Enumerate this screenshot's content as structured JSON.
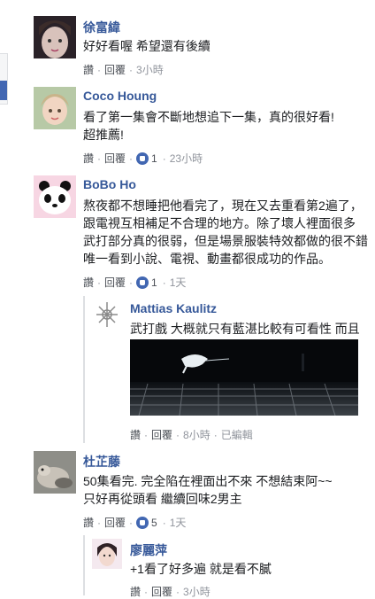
{
  "comments": [
    {
      "name": "徐富緯",
      "lines": [
        "好好看喔 希望還有後續"
      ],
      "actions": {
        "like": "讚",
        "reply": "回覆",
        "time": "3小時"
      }
    },
    {
      "name": "Coco Houng",
      "lines": [
        "看了第一集會不斷地想追下一集，真的很好看!",
        "超推薦!"
      ],
      "actions": {
        "like": "讚",
        "reply": "回覆",
        "reactions": "1",
        "time": "23小時"
      }
    },
    {
      "name": "BoBo Ho",
      "lines": [
        "熬夜都不想睡把他看完了，現在又去重看第2遍了，",
        "跟電視互相補足不合理的地方。除了壞人裡面很多",
        "武打部分真的很弱，但是場景服裝特效都做的很不錯",
        "唯一看到小說、電視、動畫都很成功的作品。"
      ],
      "actions": {
        "like": "讚",
        "reply": "回覆",
        "reactions": "1",
        "time": "1天"
      }
    },
    {
      "name": "杜芷藤",
      "lines": [
        "50集看完. 完全陷在裡面出不來 不想結束阿~~",
        "只好再從頭看 繼續回味2男主"
      ],
      "actions": {
        "like": "讚",
        "reply": "回覆",
        "reactions": "5",
        "time": "1天"
      }
    }
  ],
  "replies": [
    {
      "name": "Mattias Kaulitz",
      "lines": [
        "武打戲 大概就只有藍湛比較有可看性 而且"
      ],
      "actions": {
        "like": "讚",
        "reply": "回覆",
        "time": "8小時",
        "edited": "已編輯"
      }
    },
    {
      "name": "廖麗萍",
      "lines": [
        "+1看了好多遍 就是看不膩"
      ],
      "actions": {
        "like": "讚",
        "reply": "回覆",
        "time": "3小時"
      }
    }
  ],
  "separator": "·"
}
